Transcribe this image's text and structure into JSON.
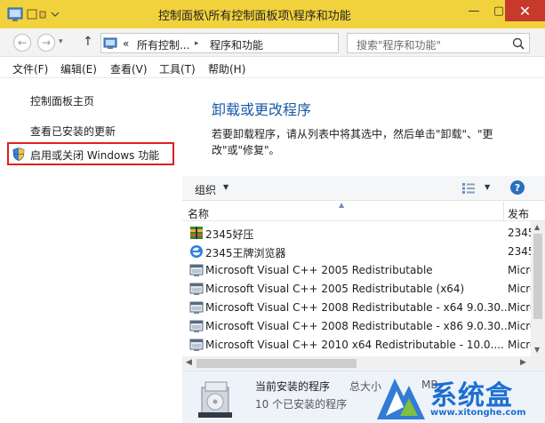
{
  "window": {
    "title": "控制面板\\所有控制面板项\\程序和功能",
    "min_glyph": "—",
    "max_glyph": "▢",
    "close_glyph": "✕"
  },
  "addressbar": {
    "back_glyph": "←",
    "forward_glyph": "→",
    "recent_glyph": "▾",
    "up_glyph": "↑",
    "overflow": "«",
    "crumbs": [
      "所有控制...",
      "程序和功能"
    ],
    "separator": "▸",
    "dropdown_glyph": "▾",
    "refresh_glyph": "↻",
    "search_placeholder": "搜索\"程序和功能\""
  },
  "menu": [
    "文件(F)",
    "编辑(E)",
    "查看(V)",
    "工具(T)",
    "帮助(H)"
  ],
  "sidebar": {
    "home": "控制面板主页",
    "updates": "查看已安装的更新",
    "features": "启用或关闭 Windows 功能"
  },
  "main": {
    "heading": "卸载或更改程序",
    "description": "若要卸载程序，请从列表中将其选中，然后单击\"卸载\"、\"更改\"或\"修复\"。"
  },
  "toolbar": {
    "organize": "组织",
    "caret": "▼",
    "help": "?"
  },
  "list": {
    "col_name": "名称",
    "col_publisher": "发布",
    "sort_glyph": "▲",
    "rows": [
      {
        "name": "2345好压",
        "publisher": "2345",
        "icon": "zip-archive-icon"
      },
      {
        "name": "2345王牌浏览器",
        "publisher": "2345",
        "icon": "browser-icon"
      },
      {
        "name": "Microsoft Visual C++ 2005 Redistributable",
        "publisher": "Microsoft",
        "icon": "installer-icon"
      },
      {
        "name": "Microsoft Visual C++ 2005 Redistributable (x64)",
        "publisher": "Microsoft",
        "icon": "installer-icon"
      },
      {
        "name": "Microsoft Visual C++ 2008 Redistributable - x64 9.0.30...",
        "publisher": "Microsoft",
        "icon": "installer-icon"
      },
      {
        "name": "Microsoft Visual C++ 2008 Redistributable - x86 9.0.30...",
        "publisher": "Microsoft",
        "icon": "installer-icon"
      },
      {
        "name": "Microsoft Visual C++ 2010  x64 Redistributable - 10.0....",
        "publisher": "Microsoft",
        "icon": "installer-icon"
      }
    ]
  },
  "scroll": {
    "up": "▲",
    "down": "▼",
    "left": "◀",
    "right": "▶"
  },
  "status": {
    "title": "当前安装的程序",
    "size_label": "总大小",
    "size_unit": "MB",
    "count": "10 个已安装的程序"
  },
  "watermark": {
    "brand": "系统盒",
    "url": "www.xitonghe.com"
  },
  "colors": {
    "titlebar": "#f1d23c",
    "close": "#c7392b",
    "link_heading": "#1a5aa6",
    "highlight_border": "#e02020",
    "watermark": "#1d6fd0"
  }
}
